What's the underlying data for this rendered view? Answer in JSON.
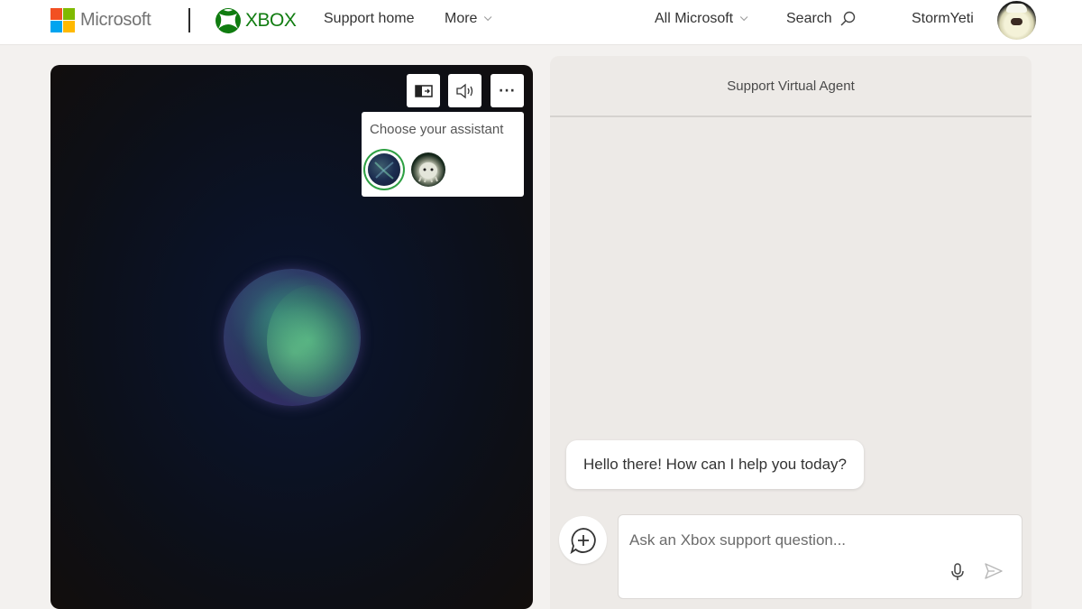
{
  "header": {
    "brand": "Microsoft",
    "product": "XBOX",
    "nav": [
      {
        "label": "Support home",
        "has_dropdown": false
      },
      {
        "label": "More",
        "has_dropdown": true
      }
    ],
    "right_nav": [
      {
        "label": "All Microsoft",
        "has_dropdown": true
      },
      {
        "label": "Search",
        "icon": "search-icon"
      }
    ],
    "username": "StormYeti",
    "colors": {
      "ms_red": "#f25022",
      "ms_green": "#7fba00",
      "ms_blue": "#00a4ef",
      "ms_yellow": "#ffb900",
      "xbox_green": "#107c10"
    }
  },
  "stage": {
    "controls": [
      {
        "name": "toggle-layout",
        "icon": "panel-toggle-icon"
      },
      {
        "name": "audio",
        "icon": "speaker-icon"
      },
      {
        "name": "more-options",
        "icon": "ellipsis-icon",
        "label": "···"
      }
    ],
    "assistant_picker": {
      "title": "Choose your assistant",
      "options": [
        {
          "name": "orb",
          "selected": true
        },
        {
          "name": "yeti",
          "selected": false
        }
      ],
      "selected_color": "#2ea043"
    }
  },
  "chat": {
    "title": "Support Virtual Agent",
    "messages": [
      {
        "from": "agent",
        "text": "Hello there! How can I help you today?"
      }
    ],
    "input": {
      "placeholder": "Ask an Xbox support question...",
      "value": ""
    }
  }
}
